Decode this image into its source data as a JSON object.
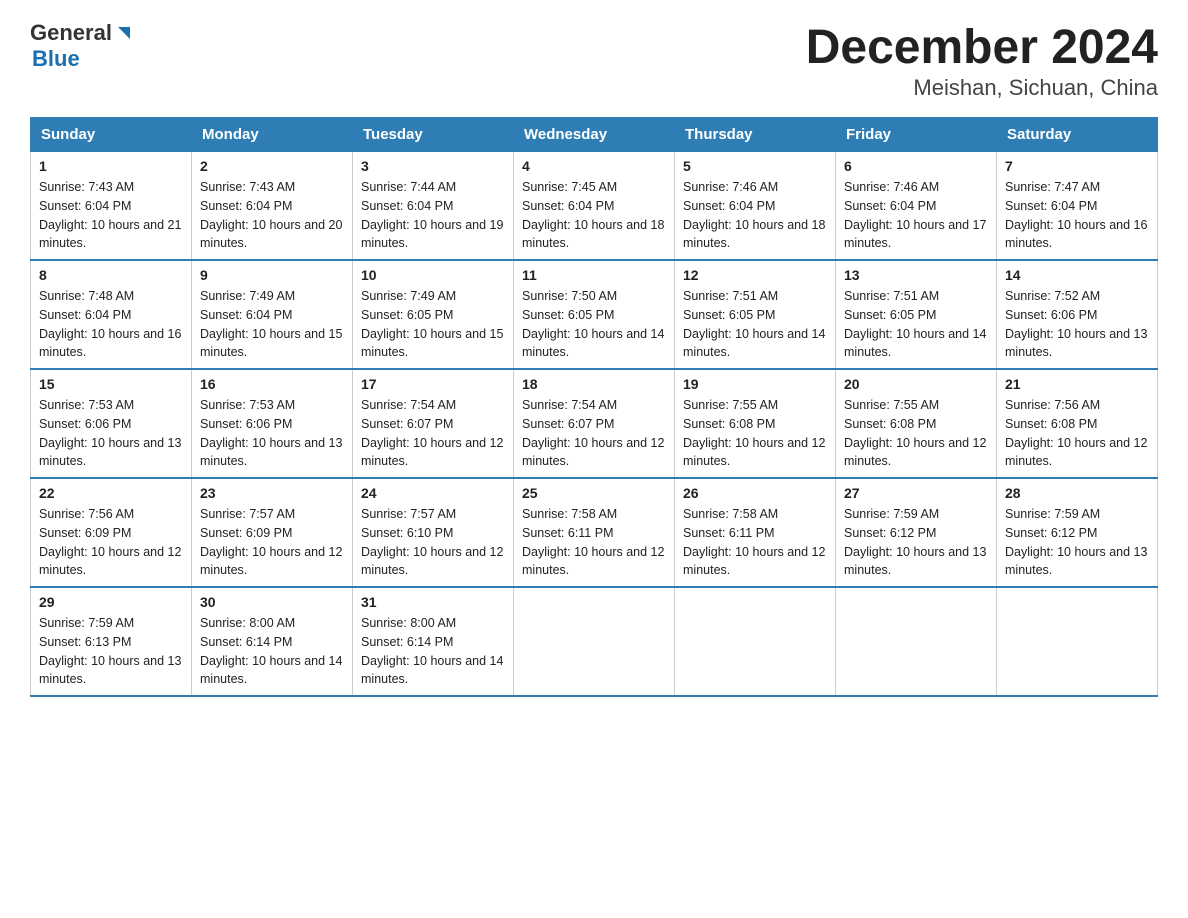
{
  "header": {
    "logo_general": "General",
    "logo_blue": "Blue",
    "title": "December 2024",
    "subtitle": "Meishan, Sichuan, China"
  },
  "days_of_week": [
    "Sunday",
    "Monday",
    "Tuesday",
    "Wednesday",
    "Thursday",
    "Friday",
    "Saturday"
  ],
  "weeks": [
    [
      {
        "day": "1",
        "sunrise": "7:43 AM",
        "sunset": "6:04 PM",
        "daylight": "10 hours and 21 minutes."
      },
      {
        "day": "2",
        "sunrise": "7:43 AM",
        "sunset": "6:04 PM",
        "daylight": "10 hours and 20 minutes."
      },
      {
        "day": "3",
        "sunrise": "7:44 AM",
        "sunset": "6:04 PM",
        "daylight": "10 hours and 19 minutes."
      },
      {
        "day": "4",
        "sunrise": "7:45 AM",
        "sunset": "6:04 PM",
        "daylight": "10 hours and 18 minutes."
      },
      {
        "day": "5",
        "sunrise": "7:46 AM",
        "sunset": "6:04 PM",
        "daylight": "10 hours and 18 minutes."
      },
      {
        "day": "6",
        "sunrise": "7:46 AM",
        "sunset": "6:04 PM",
        "daylight": "10 hours and 17 minutes."
      },
      {
        "day": "7",
        "sunrise": "7:47 AM",
        "sunset": "6:04 PM",
        "daylight": "10 hours and 16 minutes."
      }
    ],
    [
      {
        "day": "8",
        "sunrise": "7:48 AM",
        "sunset": "6:04 PM",
        "daylight": "10 hours and 16 minutes."
      },
      {
        "day": "9",
        "sunrise": "7:49 AM",
        "sunset": "6:04 PM",
        "daylight": "10 hours and 15 minutes."
      },
      {
        "day": "10",
        "sunrise": "7:49 AM",
        "sunset": "6:05 PM",
        "daylight": "10 hours and 15 minutes."
      },
      {
        "day": "11",
        "sunrise": "7:50 AM",
        "sunset": "6:05 PM",
        "daylight": "10 hours and 14 minutes."
      },
      {
        "day": "12",
        "sunrise": "7:51 AM",
        "sunset": "6:05 PM",
        "daylight": "10 hours and 14 minutes."
      },
      {
        "day": "13",
        "sunrise": "7:51 AM",
        "sunset": "6:05 PM",
        "daylight": "10 hours and 14 minutes."
      },
      {
        "day": "14",
        "sunrise": "7:52 AM",
        "sunset": "6:06 PM",
        "daylight": "10 hours and 13 minutes."
      }
    ],
    [
      {
        "day": "15",
        "sunrise": "7:53 AM",
        "sunset": "6:06 PM",
        "daylight": "10 hours and 13 minutes."
      },
      {
        "day": "16",
        "sunrise": "7:53 AM",
        "sunset": "6:06 PM",
        "daylight": "10 hours and 13 minutes."
      },
      {
        "day": "17",
        "sunrise": "7:54 AM",
        "sunset": "6:07 PM",
        "daylight": "10 hours and 12 minutes."
      },
      {
        "day": "18",
        "sunrise": "7:54 AM",
        "sunset": "6:07 PM",
        "daylight": "10 hours and 12 minutes."
      },
      {
        "day": "19",
        "sunrise": "7:55 AM",
        "sunset": "6:08 PM",
        "daylight": "10 hours and 12 minutes."
      },
      {
        "day": "20",
        "sunrise": "7:55 AM",
        "sunset": "6:08 PM",
        "daylight": "10 hours and 12 minutes."
      },
      {
        "day": "21",
        "sunrise": "7:56 AM",
        "sunset": "6:08 PM",
        "daylight": "10 hours and 12 minutes."
      }
    ],
    [
      {
        "day": "22",
        "sunrise": "7:56 AM",
        "sunset": "6:09 PM",
        "daylight": "10 hours and 12 minutes."
      },
      {
        "day": "23",
        "sunrise": "7:57 AM",
        "sunset": "6:09 PM",
        "daylight": "10 hours and 12 minutes."
      },
      {
        "day": "24",
        "sunrise": "7:57 AM",
        "sunset": "6:10 PM",
        "daylight": "10 hours and 12 minutes."
      },
      {
        "day": "25",
        "sunrise": "7:58 AM",
        "sunset": "6:11 PM",
        "daylight": "10 hours and 12 minutes."
      },
      {
        "day": "26",
        "sunrise": "7:58 AM",
        "sunset": "6:11 PM",
        "daylight": "10 hours and 12 minutes."
      },
      {
        "day": "27",
        "sunrise": "7:59 AM",
        "sunset": "6:12 PM",
        "daylight": "10 hours and 13 minutes."
      },
      {
        "day": "28",
        "sunrise": "7:59 AM",
        "sunset": "6:12 PM",
        "daylight": "10 hours and 13 minutes."
      }
    ],
    [
      {
        "day": "29",
        "sunrise": "7:59 AM",
        "sunset": "6:13 PM",
        "daylight": "10 hours and 13 minutes."
      },
      {
        "day": "30",
        "sunrise": "8:00 AM",
        "sunset": "6:14 PM",
        "daylight": "10 hours and 14 minutes."
      },
      {
        "day": "31",
        "sunrise": "8:00 AM",
        "sunset": "6:14 PM",
        "daylight": "10 hours and 14 minutes."
      },
      {
        "day": "",
        "sunrise": "",
        "sunset": "",
        "daylight": ""
      },
      {
        "day": "",
        "sunrise": "",
        "sunset": "",
        "daylight": ""
      },
      {
        "day": "",
        "sunrise": "",
        "sunset": "",
        "daylight": ""
      },
      {
        "day": "",
        "sunrise": "",
        "sunset": "",
        "daylight": ""
      }
    ]
  ]
}
